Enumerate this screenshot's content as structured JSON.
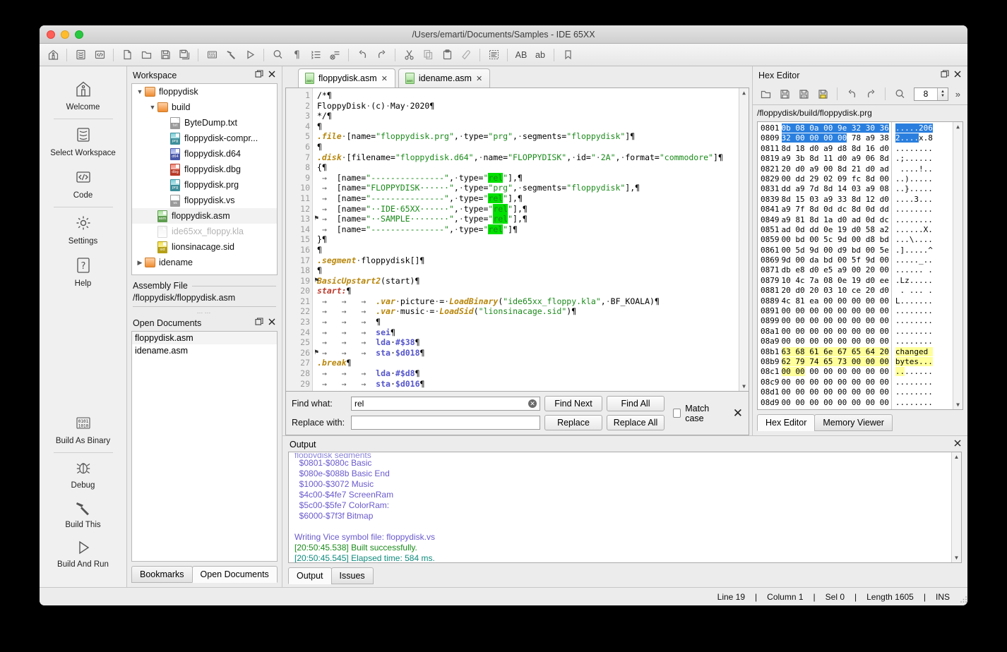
{
  "window": {
    "title": "/Users/emarti/Documents/Samples - IDE 65XX"
  },
  "toolbar": {
    "groups": [
      [
        {
          "name": "home-icon",
          "glyph": "home"
        }
      ],
      [
        {
          "name": "database-icon",
          "glyph": "db"
        },
        {
          "name": "code-icon",
          "glyph": "code"
        }
      ],
      [
        {
          "name": "new-file-icon",
          "glyph": "file"
        },
        {
          "name": "open-folder-icon",
          "glyph": "folder"
        },
        {
          "name": "save-icon",
          "glyph": "save"
        },
        {
          "name": "save-all-icon",
          "glyph": "saveall"
        }
      ],
      [
        {
          "name": "build-as-binary-icon",
          "glyph": "binary"
        },
        {
          "name": "build-hammer-icon",
          "glyph": "hammer"
        },
        {
          "name": "run-icon",
          "glyph": "play"
        }
      ],
      [
        {
          "name": "search-icon",
          "glyph": "search"
        },
        {
          "name": "pilcrow-icon",
          "glyph": "pilcrow"
        },
        {
          "name": "list-icon",
          "glyph": "list"
        },
        {
          "name": "clear-list-icon",
          "glyph": "listx"
        }
      ],
      [
        {
          "name": "undo-icon",
          "glyph": "undo"
        },
        {
          "name": "redo-icon",
          "glyph": "redo"
        }
      ],
      [
        {
          "name": "cut-icon",
          "glyph": "cut"
        },
        {
          "name": "copy-icon",
          "glyph": "copy"
        },
        {
          "name": "paste-icon",
          "glyph": "paste"
        },
        {
          "name": "eraser-icon",
          "glyph": "eraser"
        }
      ],
      [
        {
          "name": "format-icon",
          "glyph": "format"
        }
      ],
      [
        {
          "name": "uppercase-icon",
          "glyph": "AB",
          "text": "AB"
        },
        {
          "name": "lowercase-icon",
          "glyph": "ab",
          "text": "ab"
        }
      ],
      [
        {
          "name": "bookmark-icon",
          "glyph": "bookmark"
        }
      ]
    ]
  },
  "rail": {
    "items": [
      {
        "label": "Welcome",
        "icon": "home-icon"
      },
      {
        "label": "Select Workspace",
        "icon": "database-icon"
      },
      {
        "label": "Code",
        "icon": "code-icon"
      },
      {
        "label": "Settings",
        "icon": "gear-icon"
      },
      {
        "label": "Help",
        "icon": "question-icon"
      }
    ],
    "bottom_items": [
      {
        "label": "Build As Binary",
        "icon": "binary-icon"
      },
      {
        "label": "Debug",
        "icon": "bug-icon"
      },
      {
        "label": "Build This",
        "icon": "hammer-icon"
      },
      {
        "label": "Build And Run",
        "icon": "play-icon"
      }
    ]
  },
  "workspace": {
    "title": "Workspace",
    "tree": [
      {
        "label": "floppydisk",
        "indent": 0,
        "kind": "folder",
        "arrow": "down",
        "state": "normal"
      },
      {
        "label": "build",
        "indent": 1,
        "kind": "folder",
        "arrow": "down",
        "state": "normal"
      },
      {
        "label": "ByteDump.txt",
        "indent": 2,
        "kind": "txt",
        "arrow": "",
        "state": "normal"
      },
      {
        "label": "floppydisk-compr...",
        "indent": 2,
        "kind": "prg",
        "arrow": "",
        "state": "normal"
      },
      {
        "label": "floppydisk.d64",
        "indent": 2,
        "kind": "d64",
        "arrow": "",
        "state": "normal"
      },
      {
        "label": "floppydisk.dbg",
        "indent": 2,
        "kind": "dbg",
        "arrow": "",
        "state": "normal"
      },
      {
        "label": "floppydisk.prg",
        "indent": 2,
        "kind": "prg",
        "arrow": "",
        "state": "normal"
      },
      {
        "label": "floppydisk.vs",
        "indent": 2,
        "kind": "vs",
        "arrow": "",
        "state": "normal"
      },
      {
        "label": "floppydisk.asm",
        "indent": 1,
        "kind": "asm",
        "arrow": "",
        "state": "selected"
      },
      {
        "label": "ide65xx_floppy.kla",
        "indent": 1,
        "kind": "kla",
        "arrow": "",
        "state": "dim"
      },
      {
        "label": "lionsinacage.sid",
        "indent": 1,
        "kind": "sid",
        "arrow": "",
        "state": "normal"
      },
      {
        "label": "idename",
        "indent": 0,
        "kind": "folder",
        "arrow": "right",
        "state": "normal"
      }
    ]
  },
  "assembly": {
    "title": "Assembly File",
    "path": "/floppydisk/floppydisk.asm"
  },
  "open_documents": {
    "title": "Open Documents",
    "items": [
      "floppydisk.asm",
      "idename.asm"
    ],
    "tabs": [
      {
        "label": "Bookmarks",
        "active": false
      },
      {
        "label": "Open Documents",
        "active": true
      }
    ]
  },
  "editor": {
    "tabs": [
      {
        "label": "floppydisk.asm",
        "active": true,
        "close": "✕"
      },
      {
        "label": "idename.asm",
        "active": false,
        "close": "✕"
      }
    ],
    "bookmark_lines": [
      13,
      19,
      26
    ],
    "lines": [
      {
        "n": 1,
        "html": "<span class=\"pil\">/*¶</span>"
      },
      {
        "n": 2,
        "html": "FloppyDisk<span class=\"dot\">·</span>(c)<span class=\"dot\">·</span>May<span class=\"dot\">·</span>2020<span class=\"pil\">¶</span>"
      },
      {
        "n": 3,
        "html": "*/<span class=\"pil\">¶</span>"
      },
      {
        "n": 4,
        "html": "<span class=\"pil\">¶</span>"
      },
      {
        "n": 5,
        "html": "<span class=\"kw\">.file</span><span class=\"dot\">·</span>[name=<span class=\"str\">\"floppydisk.prg\"</span>,<span class=\"dot\">·</span>type=<span class=\"str\">\"prg\"</span>,<span class=\"dot\">·</span>segments=<span class=\"str\">\"floppydisk\"</span>]<span class=\"pil\">¶</span>"
      },
      {
        "n": 6,
        "html": "<span class=\"pil\">¶</span>"
      },
      {
        "n": 7,
        "html": "<span class=\"kw\">.disk</span><span class=\"dot\">·</span>[filename=<span class=\"str\">\"floppydisk.d64\"</span>,<span class=\"dot\">·</span>name=<span class=\"str\">\"FLOPPYDISK\"</span>,<span class=\"dot\">·</span>id=<span class=\"str\">\"<span class=\"dot\">·</span>2A\"</span>,<span class=\"dot\">·</span>format=<span class=\"str\">\"commodore\"</span>]<span class=\"pil\">¶</span>"
      },
      {
        "n": 8,
        "html": "{<span class=\"pil\">¶</span>"
      },
      {
        "n": 9,
        "html": " <span class=\"dot\">→</span>  [name=<span class=\"str\">\"---------------\"</span>,<span class=\"dot\">·</span>type=<span class=\"str\">\"<span class=\"hl\">rel</span>\"</span>],<span class=\"pil\">¶</span>"
      },
      {
        "n": 10,
        "html": " <span class=\"dot\">→</span>  [name=<span class=\"str\">\"FLOPPYDISK······\"</span>,<span class=\"dot\">·</span>type=<span class=\"str\">\"prg\"</span>,<span class=\"dot\">·</span>segments=<span class=\"str\">\"floppydisk\"</span>],<span class=\"pil\">¶</span>"
      },
      {
        "n": 11,
        "html": " <span class=\"dot\">→</span>  [name=<span class=\"str\">\"---------------\"</span>,<span class=\"dot\">·</span>type=<span class=\"str\">\"<span class=\"hl\">rel</span>\"</span>],<span class=\"pil\">¶</span>"
      },
      {
        "n": 12,
        "html": " <span class=\"dot\">→</span>  [name=<span class=\"str\">\"··IDE·65XX······\"</span>,<span class=\"dot\">·</span>type=<span class=\"str\">\"<span class=\"hl\">rel</span>\"</span>],<span class=\"pil\">¶</span>"
      },
      {
        "n": 13,
        "html": " <span class=\"dot\">→</span>  [name=<span class=\"str\">\"··SAMPLE········\"</span>,<span class=\"dot\">·</span>type=<span class=\"str\">\"<span class=\"hl\">rel</span>\"</span>],<span class=\"pil\">¶</span>"
      },
      {
        "n": 14,
        "html": " <span class=\"dot\">→</span>  [name=<span class=\"str\">\"---------------\"</span>,<span class=\"dot\">·</span>type=<span class=\"str\">\"<span class=\"hl\">rel</span>\"</span>]<span class=\"pil\">¶</span>"
      },
      {
        "n": 15,
        "html": "}<span class=\"pil\">¶</span>"
      },
      {
        "n": 16,
        "html": "<span class=\"pil\">¶</span>"
      },
      {
        "n": 17,
        "html": "<span class=\"kw\">.segment</span><span class=\"dot\">·</span>floppydisk[]<span class=\"pil\">¶</span>"
      },
      {
        "n": 18,
        "html": "<span class=\"pil\">¶</span>"
      },
      {
        "n": 19,
        "html": "<span class=\"kw\">BasicUpstart2</span>(start)<span class=\"pil\">¶</span>"
      },
      {
        "n": 20,
        "html": "<span class=\"kwred\">start:</span><span class=\"pil\">¶</span>"
      },
      {
        "n": 21,
        "html": " <span class=\"dot\">→</span>   <span class=\"dot\">→</span>   <span class=\"dot\">→</span>  <span class=\"kw\">.var</span><span class=\"dot\">·</span>picture<span class=\"dot\">·</span>=<span class=\"dot\">·</span><span class=\"kw\">LoadBinary</span>(<span class=\"str\">\"ide65xx_floppy.kla\"</span>,<span class=\"dot\">·</span>BF_KOALA)<span class=\"pil\">¶</span>"
      },
      {
        "n": 22,
        "html": " <span class=\"dot\">→</span>   <span class=\"dot\">→</span>   <span class=\"dot\">→</span>  <span class=\"kw\">.var</span><span class=\"dot\">·</span>music<span class=\"dot\">·</span>=<span class=\"dot\">·</span><span class=\"kw\">LoadSid</span>(<span class=\"str\">\"lionsinacage.sid\"</span>)<span class=\"pil\">¶</span>"
      },
      {
        "n": 23,
        "html": " <span class=\"dot\">→</span>   <span class=\"dot\">→</span>   <span class=\"dot\">→</span>  <span class=\"pil\">¶</span>"
      },
      {
        "n": 24,
        "html": " <span class=\"dot\">→</span>   <span class=\"dot\">→</span>   <span class=\"dot\">→</span>  <span class=\"mn\">sei</span><span class=\"pil\">¶</span>"
      },
      {
        "n": 25,
        "html": " <span class=\"dot\">→</span>   <span class=\"dot\">→</span>   <span class=\"dot\">→</span>  <span class=\"mn\">lda<span class=\"dot\">·</span>#$38</span><span class=\"pil\">¶</span>"
      },
      {
        "n": 26,
        "html": " <span class=\"dot\">→</span>   <span class=\"dot\">→</span>   <span class=\"dot\">→</span>  <span class=\"mn\">sta<span class=\"dot\">·</span>$d018</span><span class=\"pil\">¶</span>"
      },
      {
        "n": 27,
        "html": "<span class=\"kw\">.break</span><span class=\"pil\">¶</span>"
      },
      {
        "n": 28,
        "html": " <span class=\"dot\">→</span>   <span class=\"dot\">→</span>   <span class=\"dot\">→</span>  <span class=\"mn\">lda<span class=\"dot\">·</span>#$d8</span><span class=\"pil\">¶</span>"
      },
      {
        "n": 29,
        "html": " <span class=\"dot\">→</span>   <span class=\"dot\">→</span>   <span class=\"dot\">→</span>  <span class=\"mn\">sta<span class=\"dot\">·</span>$d016</span><span class=\"pil\">¶</span>"
      }
    ]
  },
  "find": {
    "find_label": "Find what:",
    "find_value": "rel",
    "replace_label": "Replace with:",
    "replace_value": "",
    "find_next": "Find Next",
    "find_all": "Find All",
    "replace": "Replace",
    "replace_all": "Replace All",
    "match_case": "Match case",
    "match_case_checked": false
  },
  "hex_editor": {
    "title": "Hex Editor",
    "path": "/floppydisk/build/floppydisk.prg",
    "bytes_per_row": "8",
    "toolbar": [
      {
        "name": "open-icon"
      },
      {
        "name": "save-icon"
      },
      {
        "name": "save-as-icon"
      },
      {
        "name": "save-all-icon"
      },
      {
        "name": "undo-icon"
      },
      {
        "name": "redo-icon"
      },
      {
        "name": "search-icon"
      }
    ],
    "overflow": "»",
    "rows": [
      {
        "off": "0801",
        "bytes": "0b 08 0a 00 9e 32 30 36",
        "ascii": ".....206",
        "style": "selected"
      },
      {
        "off": "0809",
        "bytes": "32 00 00 00 00 78 a9 38",
        "ascii": "2....x.8",
        "style": "selected-partial",
        "sel_bytes": 5,
        "sel_ascii": 5
      },
      {
        "off": "0811",
        "bytes": "8d 18 d0 a9 d8 8d 16 d0",
        "ascii": "........",
        "style": "none"
      },
      {
        "off": "0819",
        "bytes": "a9 3b 8d 11 d0 a9 06 8d",
        "ascii": ".;......",
        "style": "none"
      },
      {
        "off": "0821",
        "bytes": "20 d0 a9 00 8d 21 d0 ad",
        "ascii": " ....!..",
        "style": "none"
      },
      {
        "off": "0829",
        "bytes": "00 dd 29 02 09 fc 8d 00",
        "ascii": "..).....",
        "style": "none"
      },
      {
        "off": "0831",
        "bytes": "dd a9 7d 8d 14 03 a9 08",
        "ascii": "..}.....",
        "style": "none"
      },
      {
        "off": "0839",
        "bytes": "8d 15 03 a9 33 8d 12 d0",
        "ascii": "....3...",
        "style": "none"
      },
      {
        "off": "0841",
        "bytes": "a9 7f 8d 0d dc 8d 0d dd",
        "ascii": "........",
        "style": "none"
      },
      {
        "off": "0849",
        "bytes": "a9 81 8d 1a d0 ad 0d dc",
        "ascii": "........",
        "style": "none"
      },
      {
        "off": "0851",
        "bytes": "ad 0d dd 0e 19 d0 58 a2",
        "ascii": "......X.",
        "style": "none"
      },
      {
        "off": "0859",
        "bytes": "00 bd 00 5c 9d 00 d8 bd",
        "ascii": "...\\....",
        "style": "none"
      },
      {
        "off": "0861",
        "bytes": "00 5d 9d 00 d9 bd 00 5e",
        "ascii": ".].....^",
        "style": "none"
      },
      {
        "off": "0869",
        "bytes": "9d 00 da bd 00 5f 9d 00",
        "ascii": "....._..",
        "style": "none"
      },
      {
        "off": "0871",
        "bytes": "db e8 d0 e5 a9 00 20 00",
        "ascii": "...... .",
        "style": "none"
      },
      {
        "off": "0879",
        "bytes": "10 4c 7a 08 0e 19 d0 ee",
        "ascii": ".Lz.....",
        "style": "none"
      },
      {
        "off": "0881",
        "bytes": "20 d0 20 03 10 ce 20 d0",
        "ascii": " . ... .",
        "style": "none"
      },
      {
        "off": "0889",
        "bytes": "4c 81 ea 00 00 00 00 00",
        "ascii": "L.......",
        "style": "none"
      },
      {
        "off": "0891",
        "bytes": "00 00 00 00 00 00 00 00",
        "ascii": "........",
        "style": "none"
      },
      {
        "off": "0899",
        "bytes": "00 00 00 00 00 00 00 00",
        "ascii": "........",
        "style": "none"
      },
      {
        "off": "08a1",
        "bytes": "00 00 00 00 00 00 00 00",
        "ascii": "........",
        "style": "none"
      },
      {
        "off": "08a9",
        "bytes": "00 00 00 00 00 00 00 00",
        "ascii": "........",
        "style": "none"
      },
      {
        "off": "08b1",
        "bytes": "63 68 61 6e 67 65 64 20",
        "ascii": "changed ",
        "style": "changed"
      },
      {
        "off": "08b9",
        "bytes": "62 79 74 65 73 00 00 00",
        "ascii": "bytes...",
        "style": "changed"
      },
      {
        "off": "08c1",
        "bytes": "00 00 00 00 00 00 00 00",
        "ascii": "........",
        "style": "changed-partial",
        "sel_bytes": 2,
        "sel_ascii": 2
      },
      {
        "off": "08c9",
        "bytes": "00 00 00 00 00 00 00 00",
        "ascii": "........",
        "style": "none"
      },
      {
        "off": "08d1",
        "bytes": "00 00 00 00 00 00 00 00",
        "ascii": "........",
        "style": "none"
      },
      {
        "off": "08d9",
        "bytes": "00 00 00 00 00 00 00 00",
        "ascii": "........",
        "style": "none"
      }
    ],
    "tabs": [
      {
        "label": "Hex Editor",
        "active": true
      },
      {
        "label": "Memory Viewer",
        "active": false
      }
    ]
  },
  "output": {
    "title": "Output",
    "cut_line": "floppydisk segments",
    "lines": [
      {
        "text": "  $0801-$080c Basic",
        "color": "purple"
      },
      {
        "text": "  $080e-$088b Basic End",
        "color": "purple"
      },
      {
        "text": "  $1000-$3072 Music",
        "color": "purple"
      },
      {
        "text": "  $4c00-$4fe7 ScreenRam",
        "color": "purple"
      },
      {
        "text": "  $5c00-$5fe7 ColorRam:",
        "color": "purple"
      },
      {
        "text": "  $6000-$7f3f Bitmap",
        "color": "purple"
      },
      {
        "text": "",
        "color": "purple"
      },
      {
        "text": "Writing Vice symbol file: floppydisk.vs",
        "color": "purple"
      },
      {
        "text": "[20:50:45.538] Built successfully.",
        "color": "green"
      },
      {
        "text": "[20:50:45.545] Elapsed time: 584 ms.",
        "color": "teal"
      }
    ],
    "tabs": [
      {
        "label": "Output",
        "active": true
      },
      {
        "label": "Issues",
        "active": false
      }
    ]
  },
  "statusbar": {
    "line": "Line 19",
    "column": "Column 1",
    "sel": "Sel 0",
    "length": "Length 1605",
    "mode": "INS",
    "sep": "|"
  },
  "colors": {
    "accent_selection": "#2a7fde",
    "changed_highlight": "#ffff9b",
    "match_highlight": "#00e000",
    "success": "#1a8a1a",
    "elapsed": "#0e8b7d",
    "output_text": "#6a5acd",
    "window_bg": "#ececec"
  }
}
